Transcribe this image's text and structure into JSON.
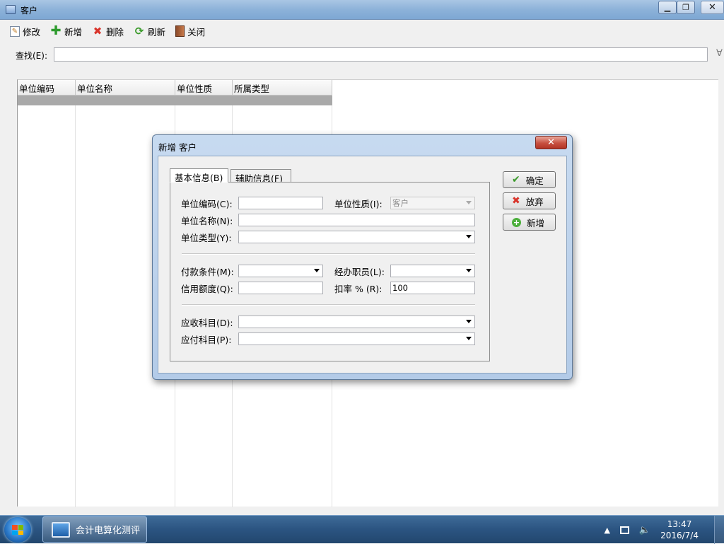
{
  "window": {
    "title": "客户",
    "min": "▁",
    "max": "❐",
    "close": "✕"
  },
  "toolbar": {
    "items": [
      {
        "label": "修改",
        "icon": "edit-icon"
      },
      {
        "label": "新增",
        "icon": "add-icon"
      },
      {
        "label": "删除",
        "icon": "delete-icon"
      },
      {
        "label": "刷新",
        "icon": "refresh-icon"
      },
      {
        "label": "关闭",
        "icon": "close-door-icon"
      }
    ]
  },
  "search": {
    "label": "查找(E):",
    "value": "",
    "filter_glyph": "∀"
  },
  "grid": {
    "columns": [
      "单位编码",
      "单位名称",
      "单位性质",
      "所属类型"
    ]
  },
  "dialog": {
    "title": "新增 客户",
    "close_glyph": "✕",
    "tabs": [
      "基本信息(B)",
      "辅助信息(F)"
    ],
    "fields": {
      "code_label": "单位编码(C):",
      "code_value": "",
      "nature_label": "单位性质(I):",
      "nature_value": "客户",
      "name_label": "单位名称(N):",
      "name_value": "",
      "type_label": "单位类型(Y):",
      "type_value": "",
      "payment_label": "付款条件(M):",
      "payment_value": "",
      "agent_label": "经办职员(L):",
      "agent_value": "",
      "credit_label": "信用额度(Q):",
      "credit_value": "",
      "discount_label": "扣率 %  (R):",
      "discount_value": "100",
      "receivable_label": "应收科目(D):",
      "receivable_value": "",
      "payable_label": "应付科目(P):",
      "payable_value": ""
    },
    "buttons": {
      "ok": "确定",
      "cancel": "放弃",
      "new": "新增"
    }
  },
  "taskbar": {
    "app_label": "会计电算化测评",
    "time": "13:47",
    "date": "2016/7/4",
    "tray_arrow": "▲"
  },
  "colors": {
    "accent": "#2b5481",
    "selected_row": "#a9a9a9",
    "ok_green": "#3a9a2a",
    "cancel_red": "#d9342b"
  }
}
